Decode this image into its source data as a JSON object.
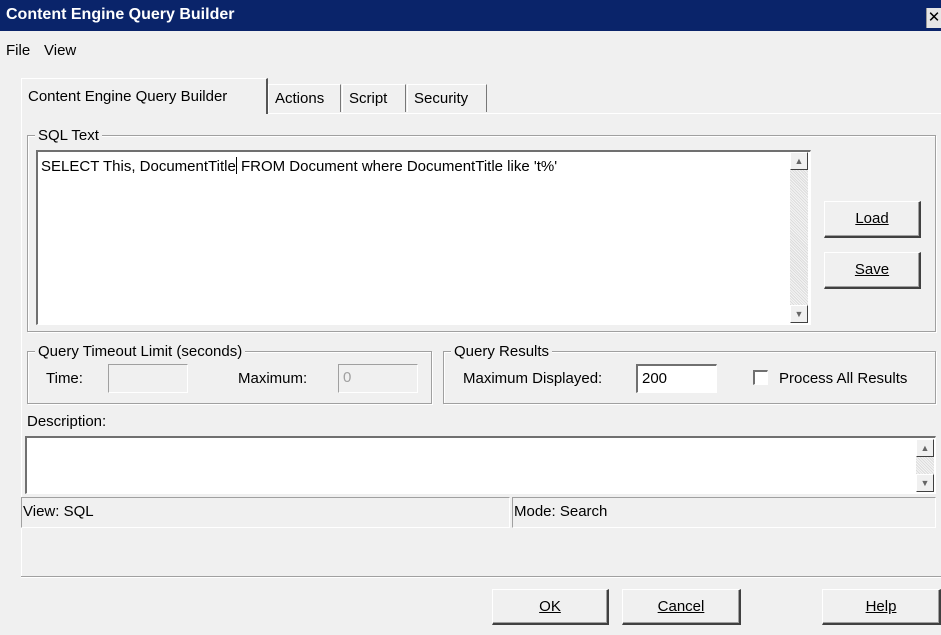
{
  "window": {
    "title": "Content Engine Query Builder",
    "close_glyph": "✕"
  },
  "menu": {
    "items": [
      {
        "label": "File"
      },
      {
        "label": "View"
      }
    ]
  },
  "tabs": [
    {
      "label": "Content Engine Query Builder",
      "active": true
    },
    {
      "label": "Actions",
      "active": false
    },
    {
      "label": "Script",
      "active": false
    },
    {
      "label": "Security",
      "active": false
    }
  ],
  "sql_text": {
    "group_label": "SQL Text",
    "value_before_cursor": "SELECT This, DocumentTitle",
    "value_after_cursor": " FROM Document where DocumentTitle like 't%'"
  },
  "sql_buttons": {
    "load": "Load",
    "save": "Save"
  },
  "timeout": {
    "group_label": "Query Timeout Limit (seconds)",
    "time_label": "Time:",
    "time_value": "",
    "maximum_label": "Maximum:",
    "maximum_value": "0"
  },
  "results": {
    "group_label": "Query Results",
    "max_displayed_label": "Maximum Displayed:",
    "max_displayed_value": "200",
    "process_all_label": "Process All Results",
    "process_all_checked": false
  },
  "description": {
    "label": "Description:",
    "value": ""
  },
  "status": {
    "view": "View: SQL",
    "mode": "Mode: Search"
  },
  "dialog_buttons": {
    "ok": "OK",
    "cancel": "Cancel",
    "help": "Help"
  },
  "colors": {
    "titlebar": "#0a246a",
    "dialog_bg": "#f0f0f0"
  }
}
